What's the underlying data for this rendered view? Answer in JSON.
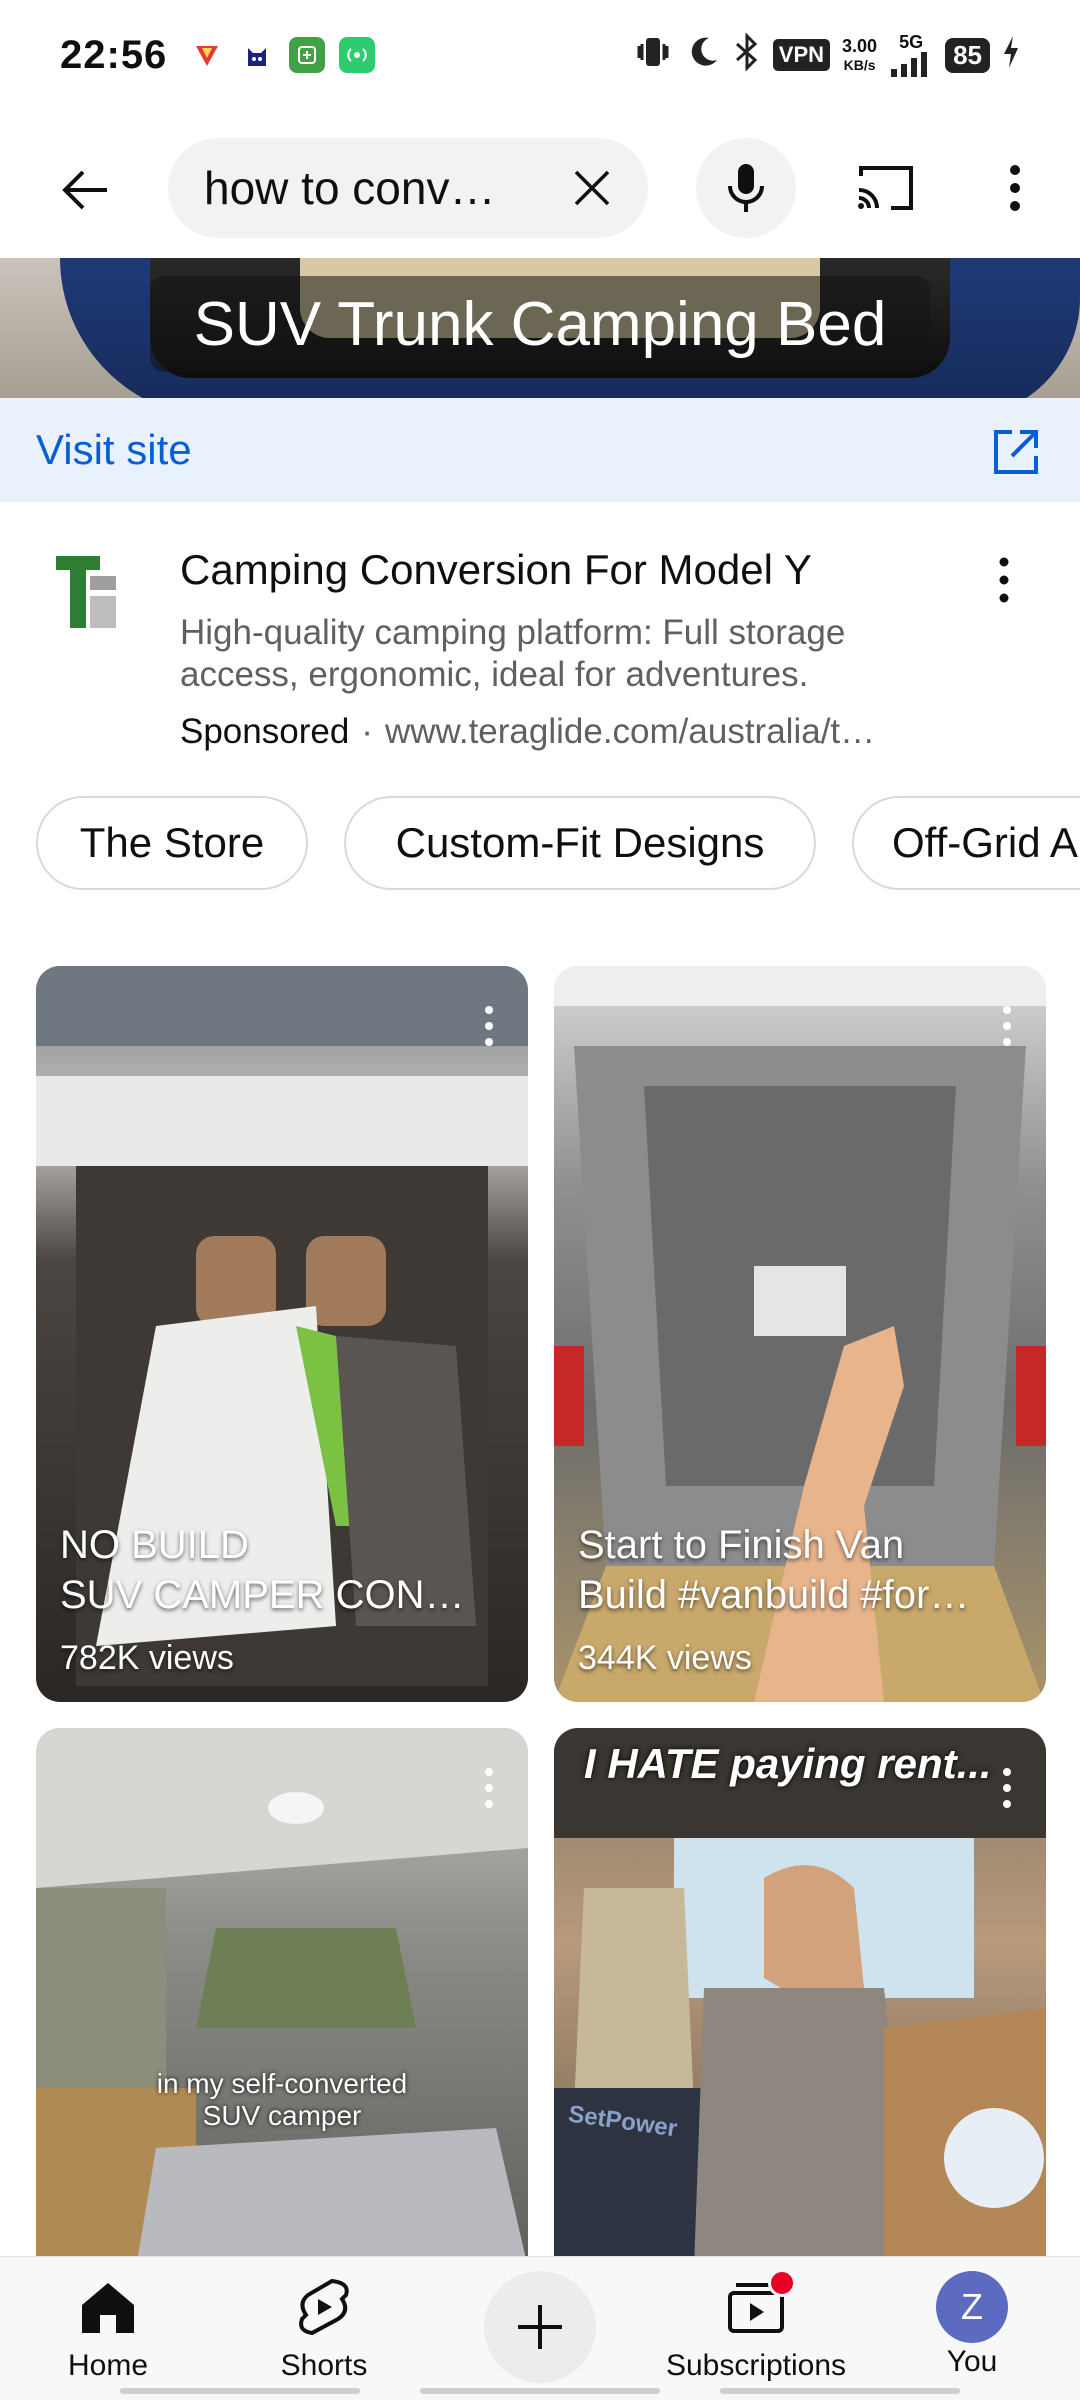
{
  "status_bar": {
    "time": "22:56",
    "vpn": "VPN",
    "speed_value": "3.00",
    "speed_unit": "KB/s",
    "network": "5G",
    "battery": "85"
  },
  "search": {
    "query": "how to conv…"
  },
  "ad": {
    "banner_title": "SUV Trunk Camping Bed",
    "visit_site": "Visit site",
    "title": "Camping Conversion For Model Y",
    "description": "High-quality camping platform: Full storage access, ergonomic, ideal for adventures.",
    "sponsored": "Sponsored",
    "url": "www.teraglide.com/australia/t…",
    "chips": [
      "The Store",
      "Custom-Fit Designs",
      "Off-Grid A"
    ]
  },
  "videos": [
    {
      "caption_line1": "NO BUILD",
      "caption_line2": "SUV CAMPER CON…",
      "views": "782K views"
    },
    {
      "caption_line1": "Start to Finish Van",
      "caption_line2": "Build #vanbuild #for…",
      "views": "344K views"
    },
    {
      "overlay_line1": "in my self-converted",
      "overlay_line2": "SUV camper"
    },
    {
      "overlay_title": "I HATE paying rent...",
      "brand_text": "SetPower"
    }
  ],
  "nav": {
    "home": "Home",
    "shorts": "Shorts",
    "subscriptions": "Subscriptions",
    "you": "You",
    "avatar_letter": "Z"
  },
  "colors": {
    "link_blue": "#065fd4",
    "visit_bg": "#e9f2fc",
    "notification_red": "#e60023",
    "avatar": "#5c6bc0"
  }
}
